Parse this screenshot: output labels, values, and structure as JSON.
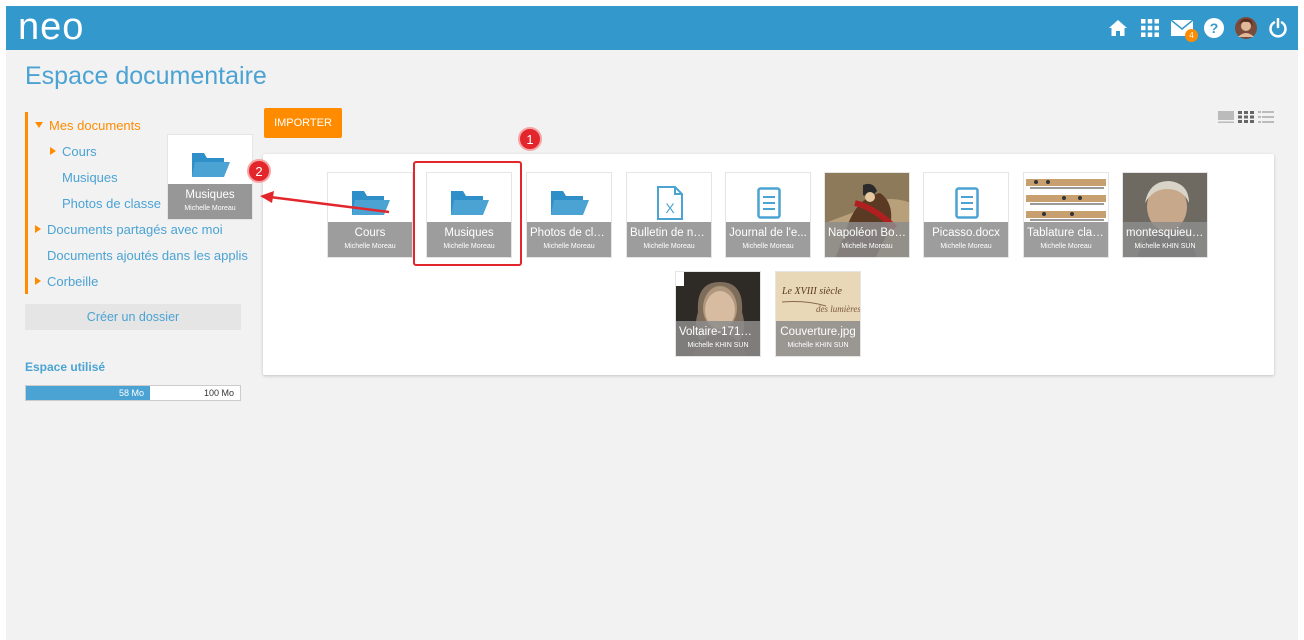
{
  "header": {
    "logo_text": "neo",
    "mail_count": "4",
    "icons": [
      "home-icon",
      "apps-grid-icon",
      "mail-icon",
      "help-icon",
      "user-avatar",
      "power-icon"
    ]
  },
  "page": {
    "title": "Espace documentaire"
  },
  "sidebar": {
    "items": [
      {
        "label": "Mes documents"
      },
      {
        "label": "Cours"
      },
      {
        "label": "Musiques"
      },
      {
        "label": "Photos de classe"
      },
      {
        "label": "Documents partagés avec moi"
      },
      {
        "label": "Documents ajoutés dans les applis"
      },
      {
        "label": "Corbeille"
      }
    ],
    "create_folder": "Créer un dossier"
  },
  "storage": {
    "label": "Espace utilisé",
    "used": "58 Mo",
    "total": "100 Mo",
    "used_fraction": 0.58
  },
  "toolbar": {
    "import_label": "IMPORTER"
  },
  "documents": [
    {
      "name": "Cours",
      "owner": "Michelle Moreau",
      "kind": "folder"
    },
    {
      "name": "Musiques",
      "owner": "Michelle Moreau",
      "kind": "folder"
    },
    {
      "name": "Photos de cla...",
      "owner": "Michelle Moreau",
      "kind": "folder"
    },
    {
      "name": "Bulletin de no...",
      "owner": "Michelle Moreau",
      "kind": "excel"
    },
    {
      "name": "Journal de l'e...",
      "owner": "Michelle Moreau",
      "kind": "doc"
    },
    {
      "name": "Napoléon Bon...",
      "owner": "Michelle Moreau",
      "kind": "image"
    },
    {
      "name": "Picasso.docx",
      "owner": "Michelle Moreau",
      "kind": "doc"
    },
    {
      "name": "Tablature clari...",
      "owner": "Michelle Moreau",
      "kind": "image"
    },
    {
      "name": "montesquieu_...",
      "owner": "Michelle KHIN SUN",
      "kind": "image"
    },
    {
      "name": "Voltaire-1718....",
      "owner": "Michelle KHIN SUN",
      "kind": "image"
    },
    {
      "name": "Couverture.jpg",
      "owner": "Michelle KHIN SUN",
      "kind": "image"
    }
  ],
  "drag_preview": {
    "name": "Musiques",
    "owner": "Michelle Moreau"
  },
  "annotations": {
    "step1": "1",
    "step2": "2"
  },
  "colors": {
    "brand": "#3399cc",
    "accent": "#ff8c00",
    "marker": "#e3262b",
    "folder": "#4ba3d4"
  }
}
